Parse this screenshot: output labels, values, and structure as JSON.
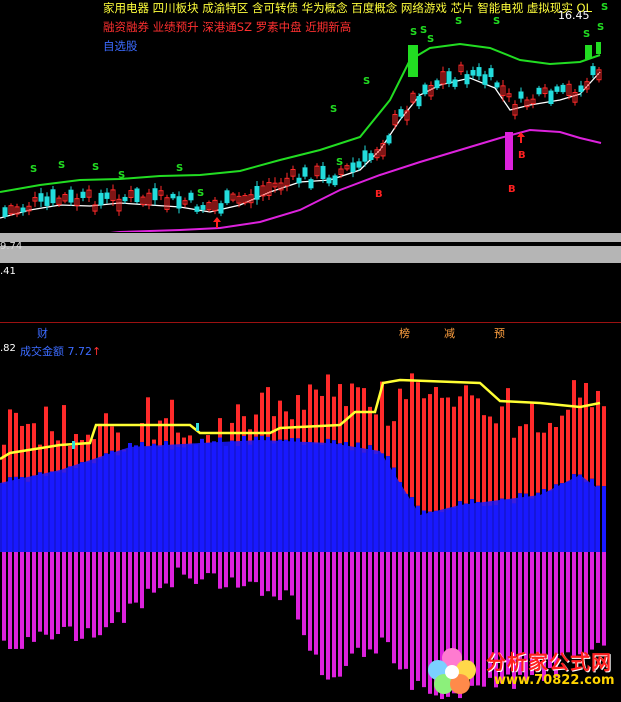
{
  "header": {
    "concepts_line1": "家用电器  四川板块  成渝特区 含可转债 华为概念 百度概念 网络游戏 芯片 智能电视 虚拟现实 OL",
    "concepts_line2": "融资融券 业绩预升 深港通SZ 罗素中盘 近期新高",
    "watchlist": "自选股",
    "high_price": "16.45"
  },
  "axis": {
    "label_a": "9.74",
    "label_b": ".41",
    "label_c": ".82"
  },
  "events": {
    "cai": "财",
    "bang": "榜",
    "jian": "减",
    "yu": "预"
  },
  "volume_legend": {
    "name": "成交金额",
    "value": "7.72",
    "arrow": "↑"
  },
  "signals": {
    "sell": "S",
    "buy": "B"
  },
  "logo": {
    "text": "分析家公式网",
    "url": "www.70822.com"
  },
  "colors": {
    "up": "#ff2a2a",
    "down": "#1a1aff",
    "ma_green": "#22dd22",
    "ma_white": "#ffffff",
    "ma_magenta": "#dd22dd",
    "vol_line": "#ffff33",
    "sell_signal": "#22dd22",
    "buy_signal": "#ff2020"
  }
}
